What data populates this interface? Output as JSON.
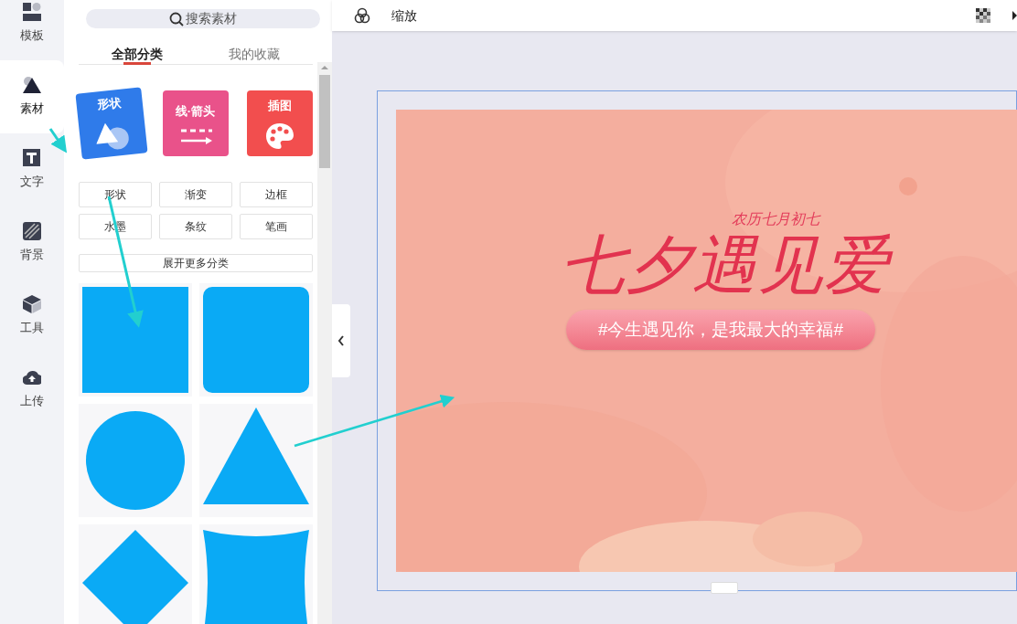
{
  "nav": [
    {
      "label": "模板",
      "selected": false
    },
    {
      "label": "素材",
      "selected": true
    },
    {
      "label": "文字",
      "selected": false
    },
    {
      "label": "背景",
      "selected": false
    },
    {
      "label": "工具",
      "selected": false
    },
    {
      "label": "上传",
      "selected": false
    }
  ],
  "search": {
    "placeholder": "搜索素材"
  },
  "tabs": [
    {
      "label": "全部分类",
      "selected": true
    },
    {
      "label": "我的收藏",
      "selected": false
    }
  ],
  "categories": [
    {
      "label": "形状",
      "color": "#2f7bea"
    },
    {
      "label": "线·箭头",
      "color": "#e9528a"
    },
    {
      "label": "插图",
      "color": "#f24e4e"
    }
  ],
  "subcategories": [
    "形状",
    "渐变",
    "边框",
    "水墨",
    "条纹",
    "笔画"
  ],
  "expand_button": "展开更多分类",
  "shapes": [
    {
      "kind": "square"
    },
    {
      "kind": "rounded-square"
    },
    {
      "kind": "circle"
    },
    {
      "kind": "triangle"
    },
    {
      "kind": "diamond"
    },
    {
      "kind": "curved-square"
    }
  ],
  "toolbar": {
    "zoom_label": "缩放"
  },
  "poster": {
    "subtitle": "农历七月初七",
    "title": "七夕遇见爱",
    "tagline": "#今生遇见你，是我最大的幸福#"
  }
}
